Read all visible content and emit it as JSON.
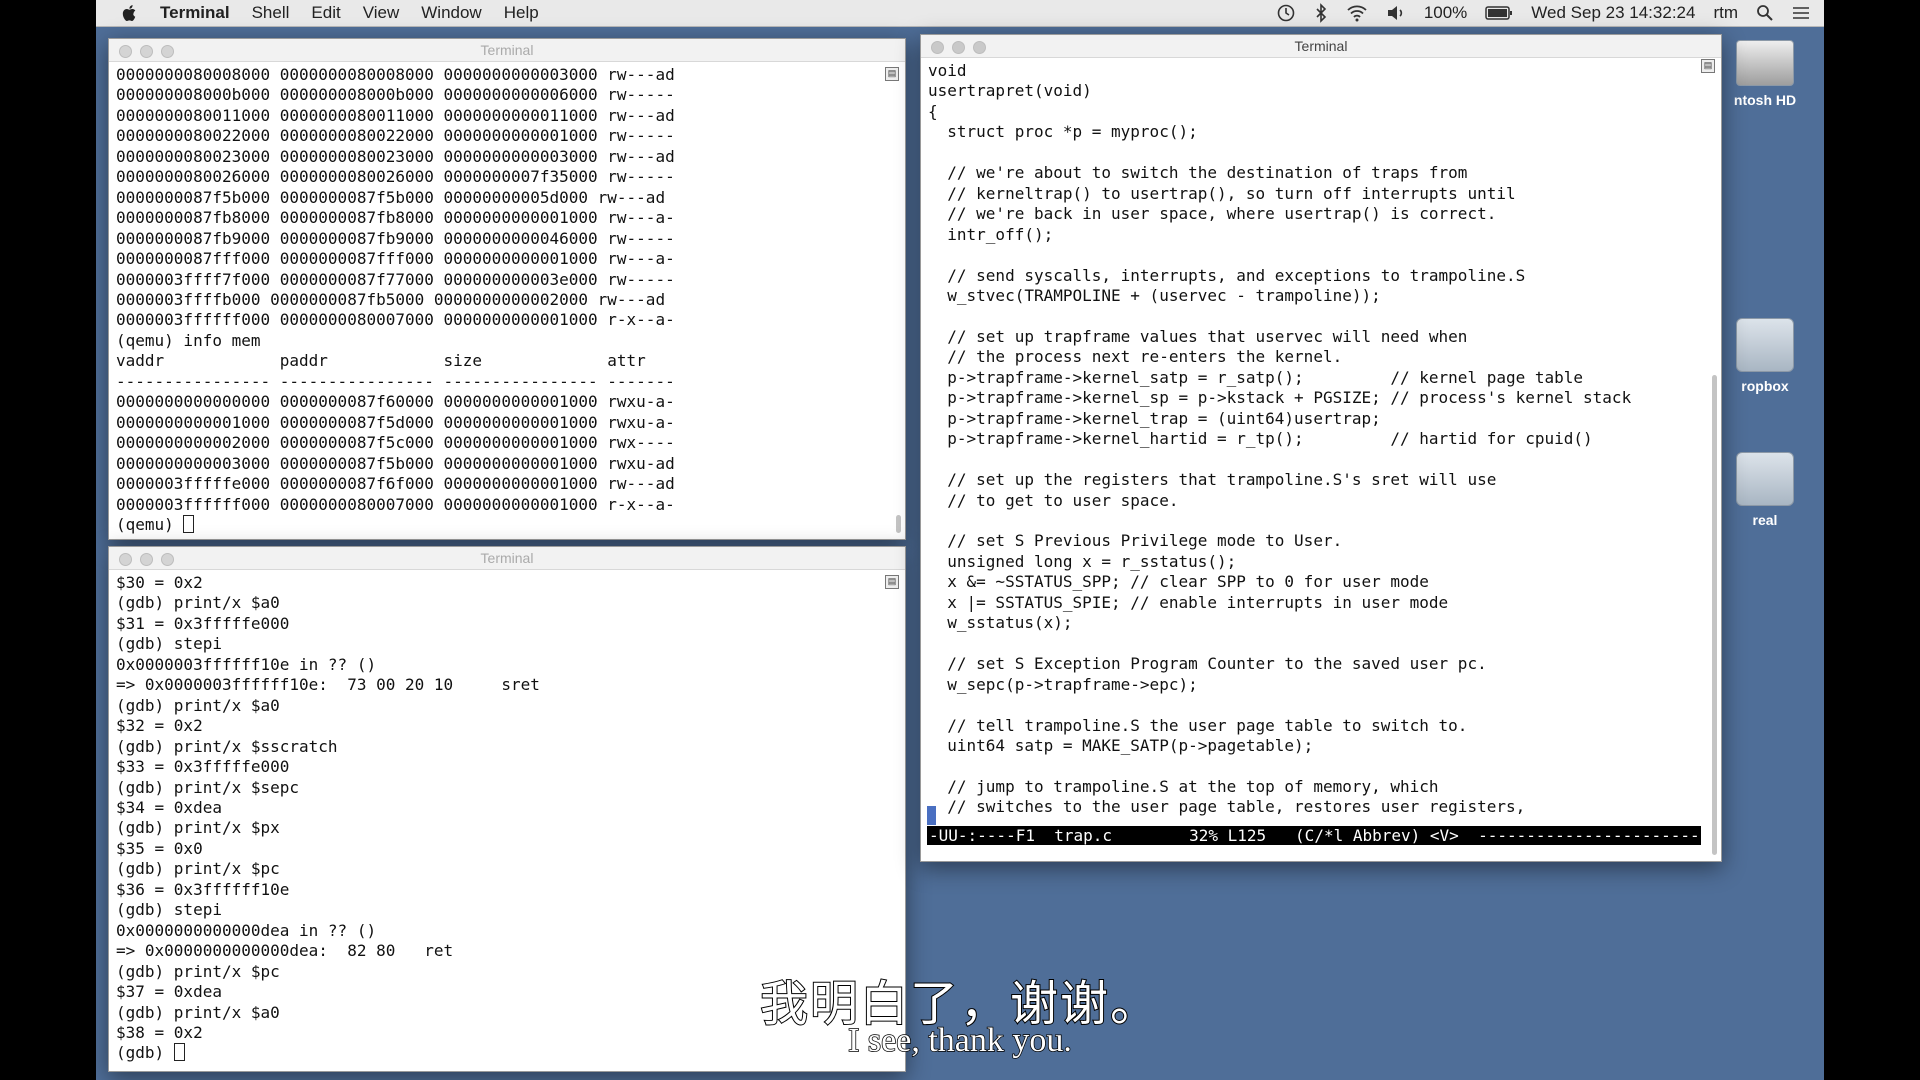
{
  "menubar": {
    "app_name": "Terminal",
    "items": [
      "Shell",
      "Edit",
      "View",
      "Window",
      "Help"
    ],
    "battery": "100%",
    "clock": "Wed Sep 23  14:32:24",
    "user": "rtm"
  },
  "desktop": {
    "icons": [
      {
        "label": "ntosh HD"
      },
      {
        "label": "ropbox"
      },
      {
        "label": "real"
      }
    ]
  },
  "windows": {
    "qemu": {
      "title": "Terminal",
      "text": "0000000080008000 0000000080008000 0000000000003000 rw---ad\n000000008000b000 000000008000b000 0000000000006000 rw-----\n0000000080011000 0000000080011000 0000000000011000 rw---ad\n0000000080022000 0000000080022000 0000000000001000 rw-----\n0000000080023000 0000000080023000 0000000000003000 rw---ad\n0000000080026000 0000000080026000 0000000007f35000 rw-----\n0000000087f5b000 0000000087f5b000 00000000005d000 rw---ad\n0000000087fb8000 0000000087fb8000 0000000000001000 rw---a-\n0000000087fb9000 0000000087fb9000 0000000000046000 rw-----\n0000000087fff000 0000000087fff000 0000000000001000 rw---a-\n0000003ffff7f000 0000000087f77000 000000000003e000 rw-----\n0000003ffffb000 0000000087fb5000 0000000000002000 rw---ad\n0000003ffffff000 0000000080007000 0000000000001000 r-x--a-\n(qemu) info mem\nvaddr            paddr            size             attr\n---------------- ---------------- ---------------- -------\n0000000000000000 0000000087f60000 0000000000001000 rwxu-a-\n0000000000001000 0000000087f5d000 0000000000001000 rwxu-a-\n0000000000002000 0000000087f5c000 0000000000001000 rwx----\n0000000000003000 0000000087f5b000 0000000000001000 rwxu-ad\n0000003fffffe000 0000000087f6f000 0000000000001000 rw---ad\n0000003ffffff000 0000000080007000 0000000000001000 r-x--a-\n(qemu) "
    },
    "gdb": {
      "title": "Terminal",
      "text": "$30 = 0x2\n(gdb) print/x $a0\n$31 = 0x3fffffe000\n(gdb) stepi\n0x0000003ffffff10e in ?? ()\n=> 0x0000003ffffff10e:  73 00 20 10     sret\n(gdb) print/x $a0\n$32 = 0x2\n(gdb) print/x $sscratch\n$33 = 0x3fffffe000\n(gdb) print/x $sepc\n$34 = 0xdea\n(gdb) print/x $px\n$35 = 0x0\n(gdb) print/x $pc\n$36 = 0x3ffffff10e\n(gdb) stepi\n0x0000000000000dea in ?? ()\n=> 0x0000000000000dea:  82 80   ret\n(gdb) print/x $pc\n$37 = 0xdea\n(gdb) print/x $a0\n$38 = 0x2\n(gdb) "
    },
    "emacs": {
      "title": "Terminal",
      "text": "void\nusertrapret(void)\n{\n  struct proc *p = myproc();\n\n  // we're about to switch the destination of traps from\n  // kerneltrap() to usertrap(), so turn off interrupts until\n  // we're back in user space, where usertrap() is correct.\n  intr_off();\n\n  // send syscalls, interrupts, and exceptions to trampoline.S\n  w_stvec(TRAMPOLINE + (uservec - trampoline));\n\n  // set up trapframe values that uservec will need when\n  // the process next re-enters the kernel.\n  p->trapframe->kernel_satp = r_satp();         // kernel page table\n  p->trapframe->kernel_sp = p->kstack + PGSIZE; // process's kernel stack\n  p->trapframe->kernel_trap = (uint64)usertrap;\n  p->trapframe->kernel_hartid = r_tp();         // hartid for cpuid()\n\n  // set up the registers that trampoline.S's sret will use\n  // to get to user space.\n\n  // set S Previous Privilege mode to User.\n  unsigned long x = r_sstatus();\n  x &= ~SSTATUS_SPP; // clear SPP to 0 for user mode\n  x |= SSTATUS_SPIE; // enable interrupts in user mode\n  w_sstatus(x);\n\n  // set S Exception Program Counter to the saved user pc.\n  w_sepc(p->trapframe->epc);\n\n  // tell trampoline.S the user page table to switch to.\n  uint64 satp = MAKE_SATP(p->pagetable);\n\n  // jump to trampoline.S at the top of memory, which\n  // switches to the user page table, restores user registers,",
      "mode_line": "-UU-:----F1  trap.c        32% L125   (C/*l Abbrev) <V>  ------------------------"
    }
  },
  "subtitles": {
    "chinese": "我明白了，谢谢。",
    "english": "I see, thank you."
  }
}
